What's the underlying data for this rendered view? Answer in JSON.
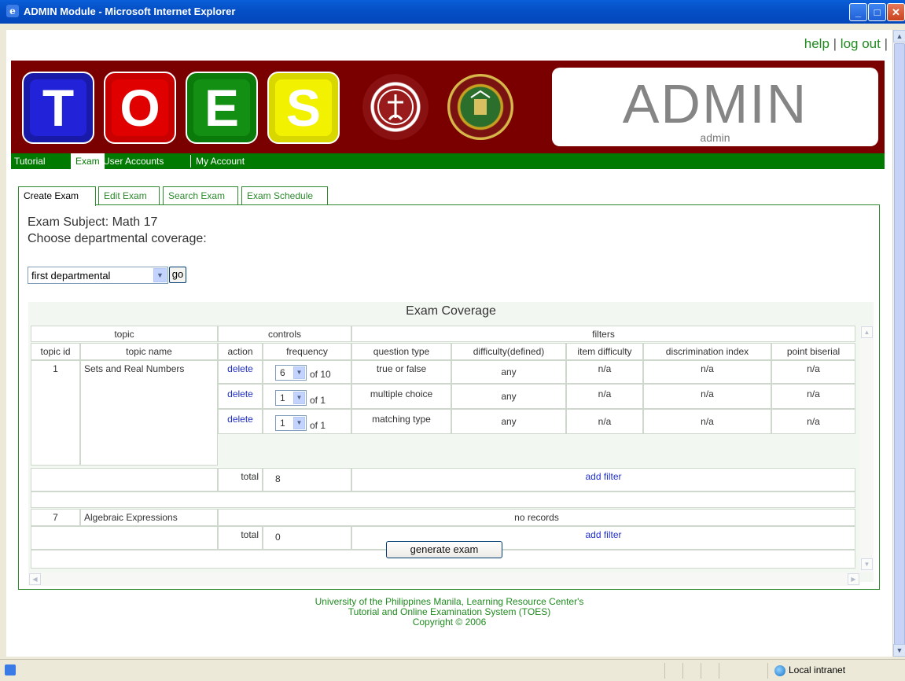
{
  "window": {
    "title": "ADMIN Module - Microsoft Internet Explorer"
  },
  "toplinks": {
    "help": "help",
    "logout": "log out",
    "sep": "|"
  },
  "banner": {
    "tiles": [
      "T",
      "O",
      "E",
      "S"
    ],
    "admin_title": "ADMIN",
    "admin_user": "admin"
  },
  "nav": {
    "items": [
      "Tutorial",
      "Exam",
      "User Accounts",
      "My Account"
    ],
    "active": "Exam"
  },
  "tabs": [
    "Create Exam",
    "Edit Exam",
    "Search Exam",
    "Exam Schedule"
  ],
  "exam": {
    "subject_line": "Exam Subject: Math 17",
    "coverage_prompt": "Choose departmental coverage:",
    "coverage_selected": "first departmental",
    "go_label": "go"
  },
  "coverage": {
    "title": "Exam Coverage",
    "group_headers": [
      "topic",
      "controls",
      "filters"
    ],
    "columns": [
      "topic id",
      "topic name",
      "action",
      "frequency",
      "question type",
      "difficulty(defined)",
      "item difficulty",
      "discrimination index",
      "point biserial"
    ],
    "topics": [
      {
        "id": "1",
        "name": "Sets and Real Numbers",
        "rows": [
          {
            "action": "delete",
            "freq": "6",
            "of": "of 10",
            "qtype": "true or false",
            "difficulty": "any",
            "item_difficulty": "n/a",
            "discrimination": "n/a",
            "biserial": "n/a"
          },
          {
            "action": "delete",
            "freq": "1",
            "of": "of 1",
            "qtype": "multiple choice",
            "difficulty": "any",
            "item_difficulty": "n/a",
            "discrimination": "n/a",
            "biserial": "n/a"
          },
          {
            "action": "delete",
            "freq": "1",
            "of": "of 1",
            "qtype": "matching type",
            "difficulty": "any",
            "item_difficulty": "n/a",
            "discrimination": "n/a",
            "biserial": "n/a"
          }
        ],
        "total_label": "total",
        "total": "8",
        "add_filter": "add filter"
      },
      {
        "id": "7",
        "name": "Algebraic Expressions",
        "no_records": "no records",
        "total_label": "total",
        "total": "0",
        "add_filter": "add filter"
      }
    ],
    "generate_label": "generate exam"
  },
  "footer": {
    "line1": "University of the Philippines Manila, Learning Resource Center's",
    "line2": "Tutorial and Online Examination System (TOES)",
    "line3": "Copyright © 2006"
  },
  "status": {
    "zone": "Local intranet"
  },
  "colors": {
    "nav_green": "#007a00",
    "banner_red": "#7a0000",
    "link_blue": "#2130c8"
  },
  "icons": [
    "ie-icon",
    "minimize-icon",
    "maximize-icon",
    "close-icon",
    "dropdown-arrow-icon",
    "globe-icon",
    "seal-logo",
    "up-seal-logo"
  ]
}
